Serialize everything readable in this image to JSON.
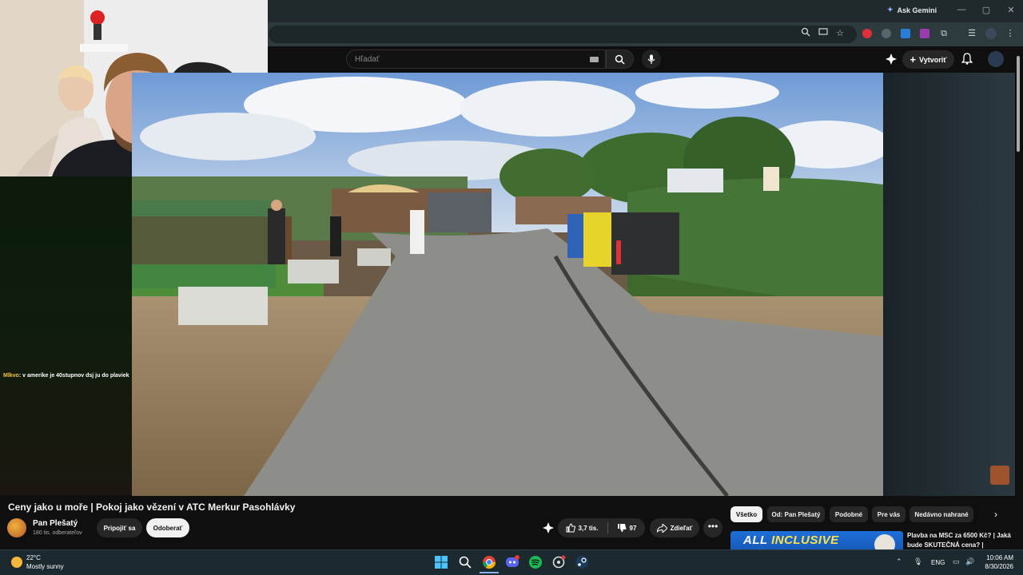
{
  "browser": {
    "ask_gemini": "Ask Gemini",
    "window_controls": [
      "—",
      "▢",
      "✕"
    ]
  },
  "youtube": {
    "search_placeholder": "Hľadať",
    "create_label": "Vytvoriť",
    "video": {
      "title": "Ceny jako u moře | Pokoj jako vězení v ATC Merkur Pasohlávky",
      "channel_name": "Pan Plešatý",
      "channel_subs": "180 tis. odberateľov",
      "join_label": "Pripojiť sa",
      "subscribe_label": "Odoberať",
      "like_count": "3,7 tis.",
      "dislike_count": "97",
      "share_label": "Zdieľať",
      "more_label": "•••"
    },
    "chips": [
      "Všetko",
      "Od: Pan Plešatý",
      "Podobné",
      "Pre vás",
      "Nedávno nahrané"
    ],
    "recommended": {
      "thumb_text_a": "ALL ",
      "thumb_text_b": "INCLUSIVE",
      "title": "Plavba na MSC za 6500 Kč? | Jaká bude SKUTEČNÁ cena? |"
    }
  },
  "chat": {
    "user": "Mlkvo",
    "message": ": v amerike je 40stupnov dsj ju do plaviek"
  },
  "taskbar": {
    "weather_temp": "22°C",
    "weather_desc": "Mostly sunny",
    "lang": "ENG",
    "time": "10:06 AM",
    "date": "8/30/2026"
  },
  "colors": {
    "youtube_bg": "#0f0f0f",
    "chrome_bar": "#202a2d",
    "taskbar": "#1c2a30",
    "chip_active": "#f1f1f1"
  }
}
